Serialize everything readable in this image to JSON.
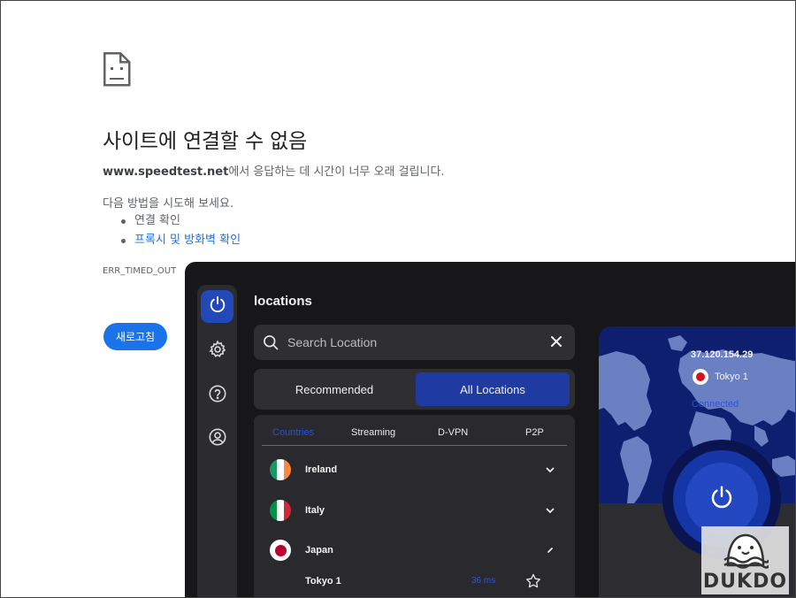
{
  "error_page": {
    "title": "사이트에 연결할 수 없음",
    "host": "www.speedtest.net",
    "description_rest": "에서 응답하는 데 시간이 너무 오래 걸립니다.",
    "try_heading": "다음 방법을 시도해 보세요.",
    "suggestions": [
      {
        "label": "연결 확인",
        "link": false
      },
      {
        "label": "프록시 및 방화벽 확인",
        "link": true
      }
    ],
    "error_code": "ERR_TIMED_OUT",
    "reload_label": "새로고침",
    "icon": "sad-page-icon"
  },
  "vpn": {
    "sidebar": [
      {
        "icon": "power-icon",
        "active": true
      },
      {
        "icon": "gear-icon",
        "active": false
      },
      {
        "icon": "help-icon",
        "active": false
      },
      {
        "icon": "account-icon",
        "active": false
      }
    ],
    "panel_title": "locations",
    "search_placeholder": "Search Location",
    "segments": [
      "Recommended",
      "All Locations"
    ],
    "active_segment": "All Locations",
    "tabs": [
      "Countries",
      "Streaming",
      "D-VPN",
      "P2P"
    ],
    "active_tab": "Countries",
    "countries": [
      {
        "name": "Ireland",
        "flag": [
          "#169b62",
          "#ffffff",
          "#ff883e"
        ],
        "expanded": false
      },
      {
        "name": "Italy",
        "flag": [
          "#009246",
          "#ffffff",
          "#ce2b37"
        ],
        "expanded": false
      },
      {
        "name": "Japan",
        "flag": [
          "#ffffff",
          "#bc002d"
        ],
        "expanded": true
      }
    ],
    "cities": [
      {
        "name": "Tokyo 1",
        "ping": "36 ms"
      }
    ],
    "connection": {
      "ip": "37.120.154.29",
      "location": "Tokyo 1",
      "status": "Connected"
    },
    "accent": "#2349b8"
  },
  "watermark": "DUKDO"
}
